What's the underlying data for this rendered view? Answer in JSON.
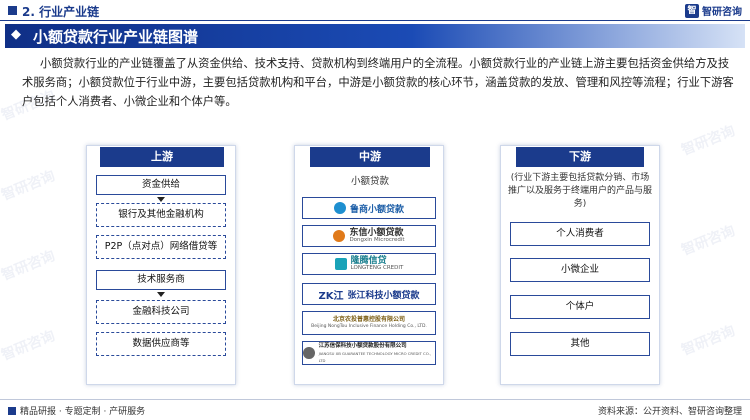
{
  "header": {
    "section": "2. 行业产业链",
    "brand": "智研咨询",
    "brand_mark": "智"
  },
  "banner": {
    "chevron": "◆",
    "title": "小额贷款行业产业链图谱"
  },
  "intro": "小额贷款行业的产业链覆盖了从资金供给、技术支持、贷款机构到终端用户的全流程。小额贷款行业的产业链上游主要包括资金供给方及技术服务商；小额贷款位于行业中游，主要包括贷款机构和平台，中游是小额贷款的核心环节，涵盖贷款的发放、管理和风控等流程；行业下游客户包括个人消费者、小微企业和个体户等。",
  "upstream": {
    "header": "上游",
    "group1_title": "资金供给",
    "group1_items": [
      "银行及其他金融机构",
      "P2P（点对点）网络借贷等"
    ],
    "group2_title": "技术服务商",
    "group2_items": [
      "金融科技公司",
      "数据供应商等"
    ]
  },
  "midstream": {
    "header": "中游",
    "subtitle": "小额贷款",
    "logos": [
      {
        "name": "鲁商小额贷款",
        "color": "#1e8fd0"
      },
      {
        "name": "东信小额贷款",
        "sub": "Dongxin Microcredit",
        "color": "#e07a1a"
      },
      {
        "name": "隆腾信贷",
        "sub": "LONGTENG CREDIT",
        "color": "#1aa3b8"
      },
      {
        "name": "张江科技小额贷款",
        "mark": "ZK江",
        "color": "#1b3b8c"
      },
      {
        "name": "北京农投普惠控股有限公司",
        "sub": "Beijing NongTou Inclusive Finance Holding Co., LTD.",
        "color": "#c9a24a"
      },
      {
        "name": "江苏信保科技小额贷款股份有限公司",
        "sub": "JIANGSU XB GUARANTEE TECHNOLOGY MICRO CREDIT CO., LTD",
        "color": "#666666"
      }
    ]
  },
  "downstream": {
    "header": "下游",
    "note": "(行业下游主要包括贷款分销、市场推广以及服务于终端用户的产品与服务)",
    "items": [
      "个人消费者",
      "小微企业",
      "个体户",
      "其他"
    ]
  },
  "watermark": "智研咨询",
  "footer": {
    "left": "精品研报 · 专题定制 · 产研服务",
    "right": "资料来源：公开资料、智研咨询整理"
  }
}
